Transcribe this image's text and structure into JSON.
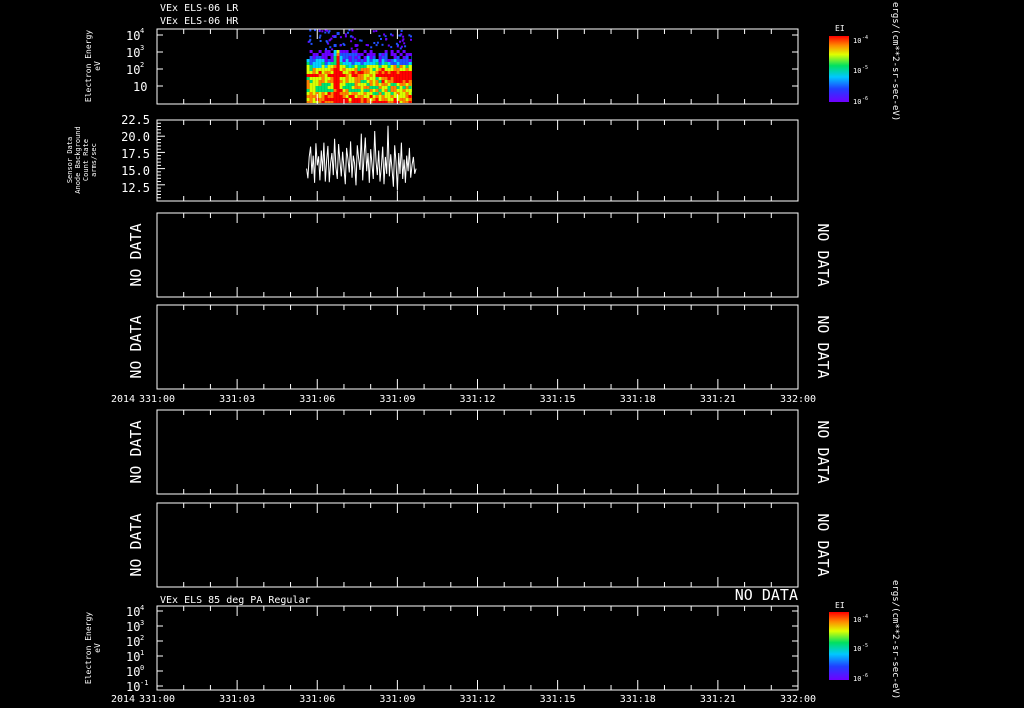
{
  "header": {
    "line1": "VEx ELS-06 LR",
    "line2": "VEx ELS-06 HR",
    "bottom_title": "VEx ELS 85 deg PA Regular"
  },
  "x_axis": {
    "year_label": "2014",
    "ticks": [
      "331:00",
      "331:03",
      "331:06",
      "331:09",
      "331:12",
      "331:15",
      "331:18",
      "331:21",
      "332:00"
    ],
    "major_tick_hours": [
      0,
      3,
      6,
      9,
      12,
      15,
      18,
      21,
      24
    ],
    "range_hours": [
      0,
      24
    ]
  },
  "no_data_text": "NO DATA",
  "panels": [
    {
      "id": "energy-spectrogram",
      "ylabel": [
        "Electron Energy",
        "eV"
      ],
      "yticks": [
        "10",
        "10",
        "10",
        "10"
      ],
      "ytick_exponents": [
        "4",
        "3",
        "2",
        ""
      ],
      "colorbar": {
        "title": "EI",
        "unit": "ergs/(cm**2-sr-sec-eV)",
        "ticks": [
          "10",
          "10",
          "10"
        ],
        "tick_exponents": [
          "-4",
          "-5",
          "-6"
        ]
      }
    },
    {
      "id": "sensor-data",
      "ylabel": [
        "Sensor Data",
        "Anode Background",
        "Count Rate",
        "arms/sec"
      ],
      "yticks": [
        "22.5",
        "20.0",
        "17.5",
        "15.0",
        "12.5"
      ]
    },
    {
      "id": "empty-panel-3",
      "left_label": "NO DATA",
      "right_label": "NO DATA"
    },
    {
      "id": "empty-panel-4",
      "left_label": "NO DATA",
      "right_label": "NO DATA"
    },
    {
      "id": "empty-panel-5",
      "left_label": "NO DATA",
      "right_label": "NO DATA"
    },
    {
      "id": "empty-panel-6",
      "left_label": "NO DATA",
      "right_label": "NO DATA"
    },
    {
      "id": "pa-spectrogram",
      "ylabel": [
        "Electron Energy",
        "eV"
      ],
      "yticks": [
        "10",
        "10",
        "10",
        "10",
        "10",
        "10"
      ],
      "ytick_exponents": [
        "4",
        "3",
        "2",
        "1",
        "0",
        "-1"
      ],
      "right_label": "NO DATA",
      "colorbar": {
        "title": "EI",
        "unit": "ergs/(cm**2-sr-sec-eV)",
        "ticks": [
          "10",
          "10",
          "10"
        ],
        "tick_exponents": [
          "-4",
          "-5",
          "-6"
        ]
      }
    }
  ],
  "chart_data": {
    "type": "line",
    "title": "VEx ELS-06 LR",
    "xlabel": "",
    "ylabel": "Sensor Data Anode Background Count Rate arms/sec",
    "x_range_hours": [
      0,
      24
    ],
    "ylim": [
      10,
      22.5
    ],
    "series": [
      {
        "x": [
          5.6,
          5.65,
          5.7,
          5.75,
          5.8,
          5.85,
          5.9,
          5.95,
          6.0,
          6.05,
          6.1,
          6.15,
          6.2,
          6.25,
          6.3,
          6.35,
          6.4,
          6.45,
          6.5,
          6.55,
          6.6,
          6.65,
          6.7,
          6.75,
          6.8,
          6.85,
          6.9,
          6.95,
          7.0,
          7.05,
          7.1,
          7.15,
          7.2,
          7.25,
          7.3,
          7.35,
          7.4,
          7.45,
          7.5,
          7.55,
          7.6,
          7.65,
          7.7,
          7.75,
          7.8,
          7.85,
          7.9,
          7.95,
          8.0,
          8.05,
          8.1,
          8.15,
          8.2,
          8.25,
          8.3,
          8.35,
          8.4,
          8.45,
          8.5,
          8.55,
          8.6,
          8.65,
          8.7,
          8.75,
          8.8,
          8.85,
          8.9,
          8.95,
          9.0,
          9.05,
          9.1,
          9.15,
          9.2,
          9.25,
          9.3,
          9.35,
          9.4,
          9.45,
          9.5,
          9.55,
          9.6,
          9.65,
          9.7
        ],
        "values": [
          15.0,
          13.5,
          16.8,
          18.4,
          14.2,
          17.0,
          12.8,
          18.9,
          15.5,
          16.9,
          13.2,
          17.8,
          14.6,
          19.0,
          13.0,
          16.2,
          18.5,
          12.9,
          15.8,
          17.4,
          14.0,
          19.6,
          15.2,
          13.4,
          18.8,
          16.0,
          13.8,
          17.6,
          15.0,
          12.6,
          18.2,
          16.4,
          14.4,
          19.2,
          13.6,
          17.0,
          15.8,
          12.4,
          18.6,
          16.6,
          14.8,
          20.4,
          13.2,
          16.8,
          19.8,
          14.6,
          17.4,
          12.8,
          18.0,
          15.6,
          13.4,
          20.8,
          16.2,
          14.0,
          17.8,
          13.0,
          15.4,
          18.4,
          12.6,
          16.8,
          14.2,
          21.6,
          13.8,
          17.2,
          15.0,
          12.2,
          18.6,
          16.0,
          11.6,
          17.4,
          14.2,
          19.0,
          13.4,
          16.4,
          12.8,
          17.0,
          14.6,
          18.2,
          13.6,
          15.6,
          16.8,
          14.2,
          15.0
        ]
      }
    ],
    "spectrogram": {
      "x_range_hours": [
        5.6,
        9.7
      ],
      "y_range_eV_log10": [
        0,
        4.2
      ],
      "colorscale": [
        "#6a00ff",
        "#2050ff",
        "#00d0ff",
        "#00e070",
        "#d8ff00",
        "#ff8000",
        "#ff0000"
      ]
    }
  }
}
